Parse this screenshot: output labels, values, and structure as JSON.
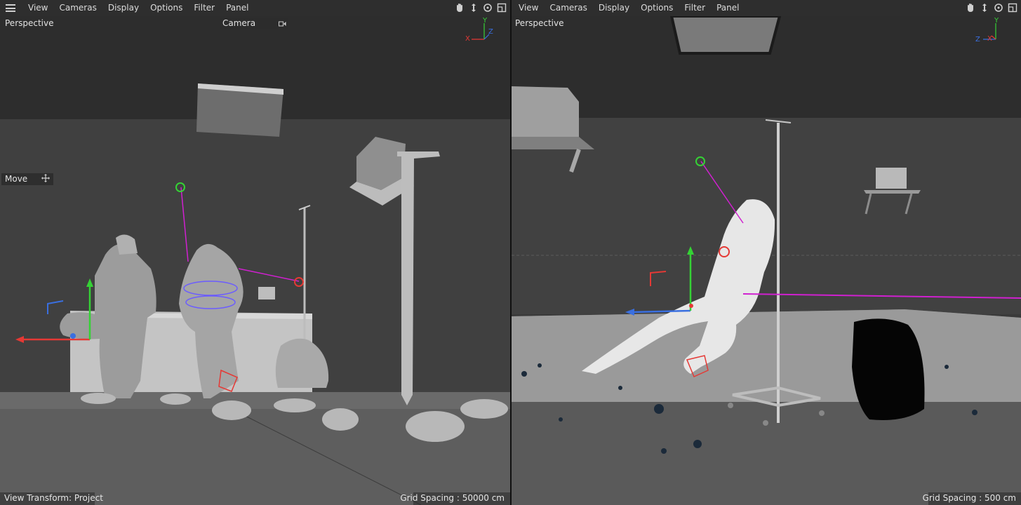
{
  "menu": {
    "items": [
      "View",
      "Cameras",
      "Display",
      "Options",
      "Filter",
      "Panel"
    ]
  },
  "left_viewport": {
    "projection": "Perspective",
    "camera_label": "Camera",
    "tool_label": "Move",
    "status_left": "View Transform: Project",
    "status_right": "Grid Spacing : 50000 cm",
    "axis_labels": {
      "x": "X",
      "y": "Y",
      "z": "Z"
    }
  },
  "right_viewport": {
    "projection": "Perspective",
    "status_right": "Grid Spacing : 500 cm",
    "axis_labels": {
      "x": "X",
      "y": "Y",
      "z": "Z"
    }
  },
  "colors": {
    "background_upper": "#2f2f2f",
    "background_wall": "#414141",
    "floor": "#5f5f5f",
    "axis_x": "#e53935",
    "axis_y": "#35d235",
    "axis_z": "#3a6fe0",
    "rig_magenta": "#d020d0"
  },
  "icons": [
    "menu-icon",
    "hand-pan-icon",
    "move-arrows-icon",
    "rotate-icon",
    "maximize-icon",
    "camera-icon",
    "move-crosshair-icon"
  ]
}
